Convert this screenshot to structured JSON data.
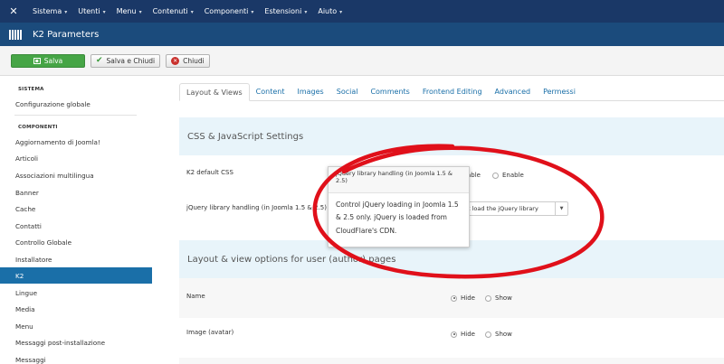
{
  "topnav": {
    "items": [
      {
        "label": "Sistema"
      },
      {
        "label": "Utenti"
      },
      {
        "label": "Menu"
      },
      {
        "label": "Contenuti"
      },
      {
        "label": "Componenti"
      },
      {
        "label": "Estensioni"
      },
      {
        "label": "Aiuto"
      }
    ]
  },
  "header": {
    "title": "K2 Parameters"
  },
  "toolbar": {
    "save_label": "Salva",
    "save_close_label": "Salva e Chiudi",
    "close_label": "Chiudi"
  },
  "sidebar": {
    "system_heading": "SISTEMA",
    "system_items": [
      {
        "label": "Configurazione globale"
      }
    ],
    "components_heading": "COMPONENTI",
    "component_items": [
      {
        "label": "Aggiornamento di Joomla!"
      },
      {
        "label": "Articoli"
      },
      {
        "label": "Associazioni multilingua"
      },
      {
        "label": "Banner"
      },
      {
        "label": "Cache"
      },
      {
        "label": "Contatti"
      },
      {
        "label": "Controllo Globale"
      },
      {
        "label": "Installatore"
      },
      {
        "label": "K2",
        "active": true
      },
      {
        "label": "Lingue"
      },
      {
        "label": "Media"
      },
      {
        "label": "Menu"
      },
      {
        "label": "Messaggi post-installazione"
      },
      {
        "label": "Messaggi"
      }
    ]
  },
  "tabs": [
    {
      "label": "Layout & Views",
      "active": true
    },
    {
      "label": "Content"
    },
    {
      "label": "Images"
    },
    {
      "label": "Social"
    },
    {
      "label": "Comments"
    },
    {
      "label": "Frontend Editing"
    },
    {
      "label": "Advanced"
    },
    {
      "label": "Permessi"
    }
  ],
  "sections": {
    "css_js": "CSS & JavaScript Settings",
    "layout_user": "Layout & view options for user (author) pages"
  },
  "fields": {
    "k2_css": {
      "label": "K2 default CSS",
      "option_disable_partial": "able",
      "option_enable": "Enable"
    },
    "jquery": {
      "label": "jQuery library handling (in Joomla 1.5 & 2.5)",
      "selected_partial": "ot load the jQuery library"
    },
    "name": {
      "label": "Name",
      "hide": "Hide",
      "show": "Show",
      "selected": "Hide"
    },
    "image": {
      "label": "Image (avatar)",
      "hide": "Hide",
      "show": "Show",
      "selected": "Hide"
    }
  },
  "tooltip": {
    "title": "jQuery library handling (in Joomla 1.5 & 2.5)",
    "body": "Control jQuery loading in Joomla 1.5 & 2.5 only. jQuery is loaded from CloudFlare's CDN."
  },
  "colors": {
    "topnav": "#1a3867",
    "titlebar": "#1b4b7c",
    "save_button": "#46a546",
    "sidebar_active": "#1a6fa8",
    "section_bg": "#e8f4fa",
    "annotation": "#e0101a"
  },
  "icons": {
    "logo": "joomla-logo-icon",
    "title": "k2-grid-icon",
    "save": "save-icon",
    "save_close": "check-icon",
    "close": "close-circle-icon"
  }
}
